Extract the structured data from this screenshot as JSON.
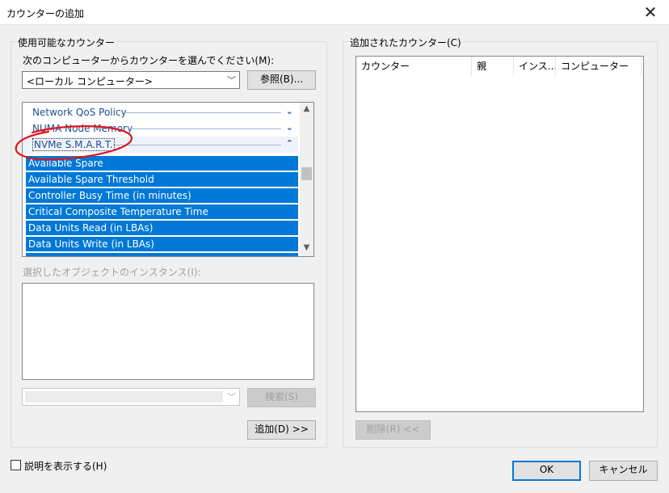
{
  "window": {
    "title": "カウンターの追加",
    "close_glyph": "✕"
  },
  "available": {
    "legend": "使用可能なカウンター",
    "computer_label": "次のコンピューターからカウンターを選んでください(M):",
    "computer_value": "<ローカル コンピューター>",
    "browse_label": "参照(B)...",
    "categories": [
      {
        "label": "Network QoS Policy",
        "chevron": "⌄"
      },
      {
        "label": "NUMA Node Memory",
        "chevron": "⌄"
      },
      {
        "label": "NVMe S.M.A.R.T.",
        "chevron": "⌃"
      }
    ],
    "counters": [
      "Available Spare",
      "Available Spare Threshold",
      "Controller Busy Time (in minutes)",
      "Critical Composite Temperature Time",
      "Data Units Read (in LBAs)",
      "Data Units Write (in LBAs)"
    ],
    "instances_label": "選択したオブジェクトのインスタンス(I):",
    "search_label": "検索(S)",
    "add_label": "追加(D) >>"
  },
  "added": {
    "legend": "追加されたカウンター(C)",
    "columns": [
      "カウンター",
      "親",
      "インス...",
      "コンピューター"
    ],
    "remove_label": "削除(R) <<"
  },
  "footer": {
    "show_description_label": "説明を表示する(H)",
    "ok_label": "OK",
    "cancel_label": "キャンセル"
  },
  "colors": {
    "selection": "#0078d7",
    "category_text": "#1e4f91",
    "annotation": "#e0141e"
  }
}
